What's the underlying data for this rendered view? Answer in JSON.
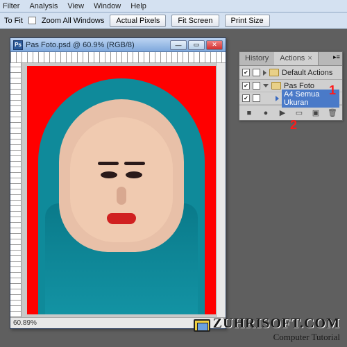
{
  "menu": {
    "items": [
      "Filter",
      "Analysis",
      "View",
      "Window",
      "Help"
    ]
  },
  "toolbar": {
    "tofit": "To Fit",
    "zoomall": "Zoom All Windows",
    "actual": "Actual Pixels",
    "fit": "Fit Screen",
    "print": "Print Size"
  },
  "doc": {
    "title": "Pas Foto.psd @ 60.9% (RGB/8)",
    "zoom": "60.89%",
    "min": "—",
    "max": "▭",
    "close": "✕"
  },
  "panel": {
    "tabs": {
      "history": "History",
      "actions": "Actions",
      "x": "×"
    },
    "rows": [
      {
        "label": "Default Actions"
      },
      {
        "label": "Pas Foto"
      },
      {
        "label": "A4 Semua Ukuran"
      }
    ],
    "foot": {
      "stop": "■",
      "rec": "●",
      "play": "▶",
      "new": "▭",
      "newact": "▣",
      "trash": "🗑"
    }
  },
  "anno": {
    "a1": "1",
    "a2": "2"
  },
  "watermark": {
    "brand": "ZUHRISOFT.COM",
    "tag": "Computer Tutorial"
  }
}
